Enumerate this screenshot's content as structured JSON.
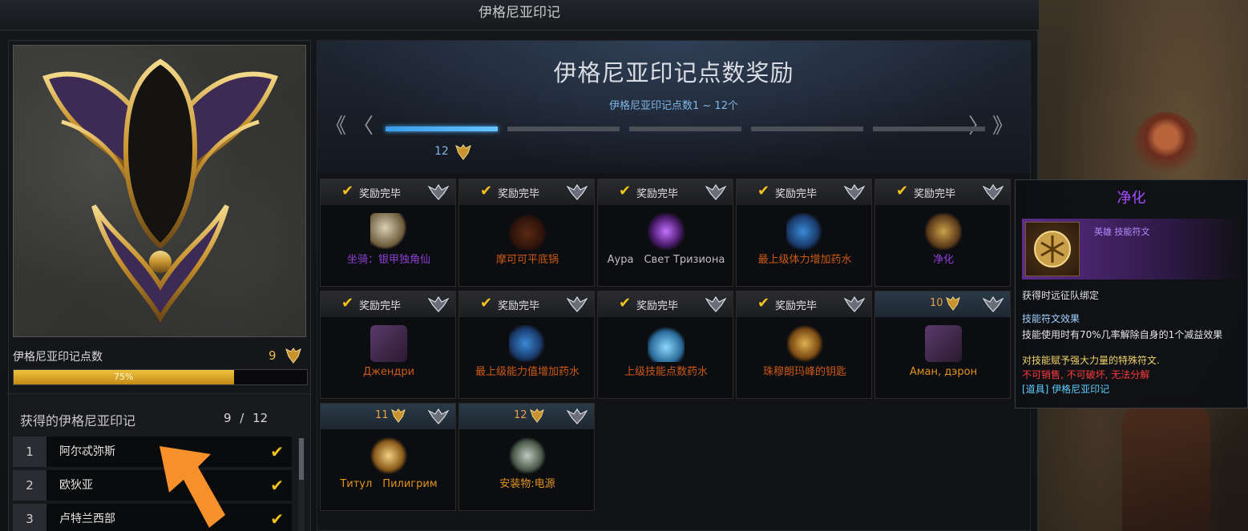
{
  "window": {
    "title": "伊格尼亚印记"
  },
  "left": {
    "points_label": "伊格尼亚印记点数",
    "points_value": "9",
    "progress": {
      "percent": 75,
      "label": "75%"
    },
    "obtained_title": "获得的伊格尼亚印记",
    "obtained_count": "9 / 12",
    "list": [
      {
        "num": "1",
        "name": "阿尔忒弥斯",
        "check": "✔"
      },
      {
        "num": "2",
        "name": "欧狄亚",
        "check": "✔"
      },
      {
        "num": "3",
        "name": "卢特兰西部",
        "check": "✔"
      }
    ]
  },
  "rewards": {
    "title": "伊格尼亚印记点数奖励",
    "subtitle": "伊格尼亚印记点数1 ~ 12个",
    "nav_prev_double": "《",
    "nav_prev": "〈",
    "nav_next": "〉",
    "nav_next_double": "》",
    "active_tier_label": "12",
    "tier_count": 5,
    "active_tier": 0,
    "status_done": "奖励完毕",
    "check": "✔",
    "items": [
      {
        "name": "坐骑：银甲独角仙",
        "status": "done",
        "color": "purple",
        "icon": "beetle-icon"
      },
      {
        "name": "摩可可平底锅",
        "status": "done",
        "color": "orange",
        "icon": "pan-icon"
      },
      {
        "name": "Аура　Свет Тризиона",
        "status": "done",
        "color": "gray",
        "icon": "aura-icon"
      },
      {
        "name": "最上级体力增加药水",
        "status": "done",
        "color": "orange",
        "icon": "potion-icon"
      },
      {
        "name": "净化",
        "status": "done",
        "color": "purple",
        "icon": "rune-icon"
      },
      {
        "name": "Джендри",
        "status": "done",
        "color": "orange",
        "icon": "card-icon"
      },
      {
        "name": "最上级能力值增加药水",
        "status": "done",
        "color": "orange",
        "icon": "potion-icon"
      },
      {
        "name": "上级技能点数药水",
        "status": "done",
        "color": "orange",
        "icon": "flask-icon"
      },
      {
        "name": "珠穆朗玛峰的钥匙",
        "status": "done",
        "color": "orange",
        "icon": "key-icon"
      },
      {
        "name": "Аман, дэрон",
        "status": "locked",
        "level": "10",
        "color": "gold",
        "icon": "card-icon"
      },
      {
        "name": "Титул　Пилигрим",
        "status": "locked",
        "level": "11",
        "color": "gold",
        "icon": "scroll-icon"
      },
      {
        "name": "安装物:电源",
        "status": "locked",
        "level": "12",
        "color": "gold",
        "icon": "device-icon"
      }
    ]
  },
  "tooltip": {
    "title": "净化",
    "type": "英雄 技能符文",
    "bind": "获得时远征队绑定",
    "effect_title": "技能符文效果",
    "effect_desc": "技能使用时有70%几率解除自身的1个减益效果",
    "flavor": "对技能赋予强大力量的特殊符文.",
    "restrict": "不可销售, 不可破坏, 无法分解",
    "source": "[道具] 伊格尼亚印记"
  },
  "colors": {
    "accent_gold": "#f2c31e",
    "tier_blue": "#4bb0ff",
    "epic_purple": "#a24dff"
  }
}
